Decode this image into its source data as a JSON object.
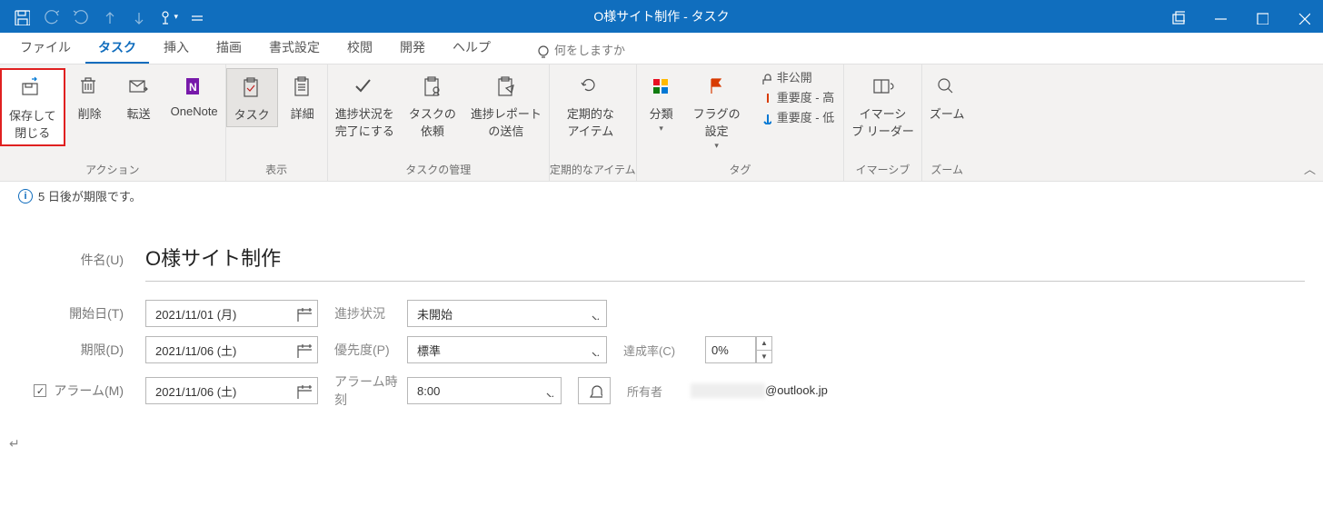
{
  "window": {
    "title": "O様サイト制作  -  タスク"
  },
  "qat": {
    "save": "保存",
    "undo": "元に戻す",
    "redo": "やり直し",
    "prev": "前へ",
    "next": "次へ",
    "touch": "タッチ/マウス モード",
    "customize": "カスタマイズ"
  },
  "tabs": {
    "file": "ファイル",
    "task": "タスク",
    "insert": "挿入",
    "draw": "描画",
    "format": "書式設定",
    "review": "校閲",
    "developer": "開発",
    "help": "ヘルプ",
    "tell_me": "何をしますか"
  },
  "ribbon": {
    "actions": {
      "label": "アクション",
      "save_close": "保存して\n閉じる",
      "delete": "削除",
      "forward": "転送",
      "onenote": "OneNote"
    },
    "show": {
      "label": "表示",
      "task": "タスク",
      "details": "詳細"
    },
    "manage": {
      "label": "タスクの管理",
      "mark_complete": "進捗状況を\n完了にする",
      "assign": "タスクの\n依頼",
      "send_report": "進捗レポート\nの送信"
    },
    "recurrence": {
      "label": "定期的なアイテム",
      "button": "定期的な\nアイテム"
    },
    "tags": {
      "label": "タグ",
      "categorize": "分類",
      "followup": "フラグの\n設定",
      "private": "非公開",
      "high": "重要度 - 高",
      "low": "重要度 - 低"
    },
    "immersive": {
      "label": "イマーシブ",
      "reader": "イマーシ\nブ リーダー"
    },
    "zoom": {
      "label": "ズーム",
      "button": "ズーム"
    }
  },
  "infobar": {
    "text": "5 日後が期限です。"
  },
  "form": {
    "subject_label": "件名(U)",
    "subject": "O様サイト制作",
    "start_label": "開始日(T)",
    "start_date": "2021/11/01 (月)",
    "status_label": "進捗状況",
    "status_value": "未開始",
    "due_label": "期限(D)",
    "due_date": "2021/11/06 (土)",
    "priority_label": "優先度(P)",
    "priority_value": "標準",
    "complete_label": "達成率(C)",
    "complete_value": "0%",
    "reminder_label": "アラーム(M)",
    "reminder_date": "2021/11/06 (土)",
    "reminder_time_label": "アラーム時刻",
    "reminder_time": "8:00",
    "owner_label": "所有者",
    "owner_value": "@outlook.jp"
  }
}
